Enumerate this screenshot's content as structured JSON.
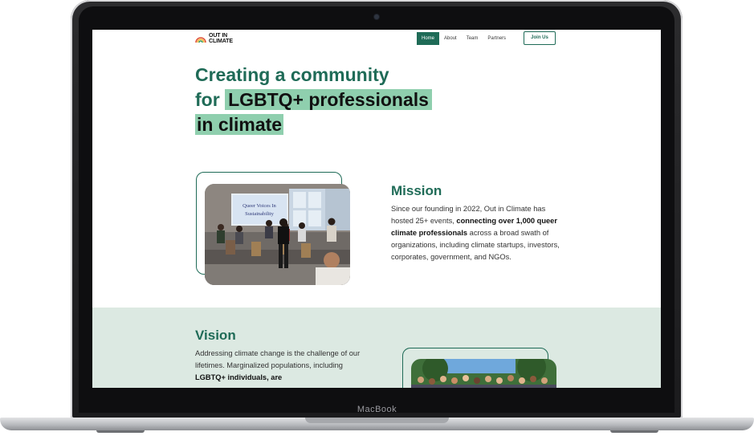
{
  "device": {
    "brand_label": "MacBook"
  },
  "site": {
    "logo_text_line1": "OUT IN",
    "logo_text_line2": "CLIMATE",
    "nav": {
      "home": "Home",
      "about": "About",
      "team": "Team",
      "partners": "Partners"
    },
    "join_label": "Join Us"
  },
  "hero": {
    "line1": "Creating a community",
    "line2_prefix": "for",
    "line2_highlight": "LGBTQ+ professionals",
    "line3_highlight": "in climate"
  },
  "mission": {
    "title": "Mission",
    "text_a": "Since our founding in 2022, Out in Climate has hosted 25+ events, ",
    "text_bold": "connecting over 1,000 queer climate professionals",
    "text_b": " across a broad swath of organizations, including climate startups, investors, corporates, government, and NGOs.",
    "photo_screen_text_1": "Queer Voices In",
    "photo_screen_text_2": "Sustainability"
  },
  "vision": {
    "title": "Vision",
    "text_a": "Addressing climate change is the challenge of our lifetimes. Marginalized populations, including ",
    "text_bold": "LGBTQ+ individuals, are"
  },
  "colors": {
    "brand_green": "#1f6b57",
    "highlight_green": "#8fcfae",
    "vision_band": "#dce9e2"
  }
}
